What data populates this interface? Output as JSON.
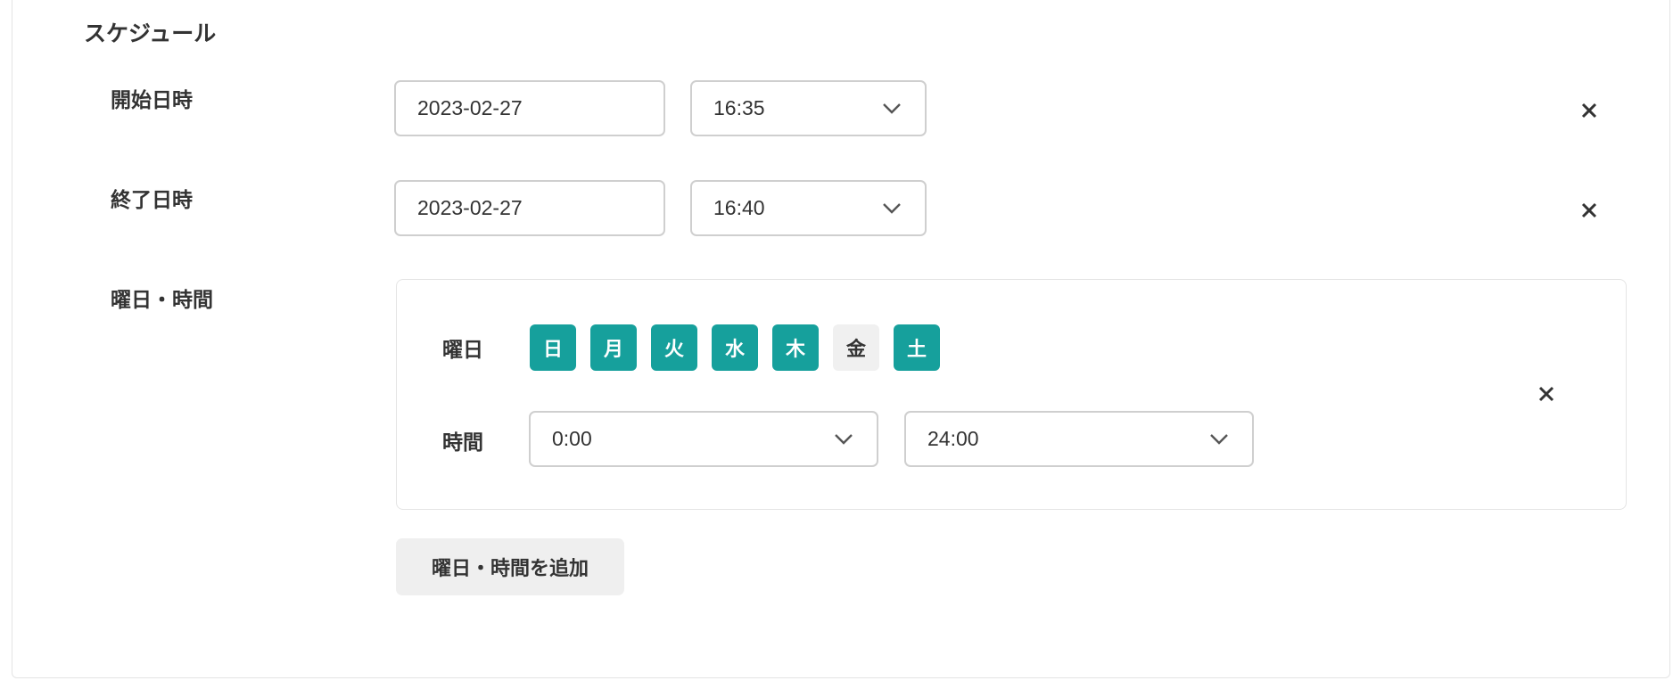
{
  "section": {
    "title": "スケジュール"
  },
  "start": {
    "label": "開始日時",
    "date": "2023-02-27",
    "time": "16:35"
  },
  "end": {
    "label": "終了日時",
    "date": "2023-02-27",
    "time": "16:40"
  },
  "weekday_time": {
    "label": "曜日・時間",
    "days_label": "曜日",
    "days": [
      {
        "label": "日",
        "selected": true
      },
      {
        "label": "月",
        "selected": true
      },
      {
        "label": "火",
        "selected": true
      },
      {
        "label": "水",
        "selected": true
      },
      {
        "label": "木",
        "selected": true
      },
      {
        "label": "金",
        "selected": false
      },
      {
        "label": "土",
        "selected": true
      }
    ],
    "time_label": "時間",
    "time_from": "0:00",
    "time_to": "24:00"
  },
  "add_button": {
    "label": "曜日・時間を追加"
  },
  "colors": {
    "accent": "#16a09c",
    "unselected_day": "#f0f0f0",
    "border": "#cfcfcf"
  },
  "icons": {
    "close": "close-icon",
    "dropdown": "chevron-down-icon"
  }
}
